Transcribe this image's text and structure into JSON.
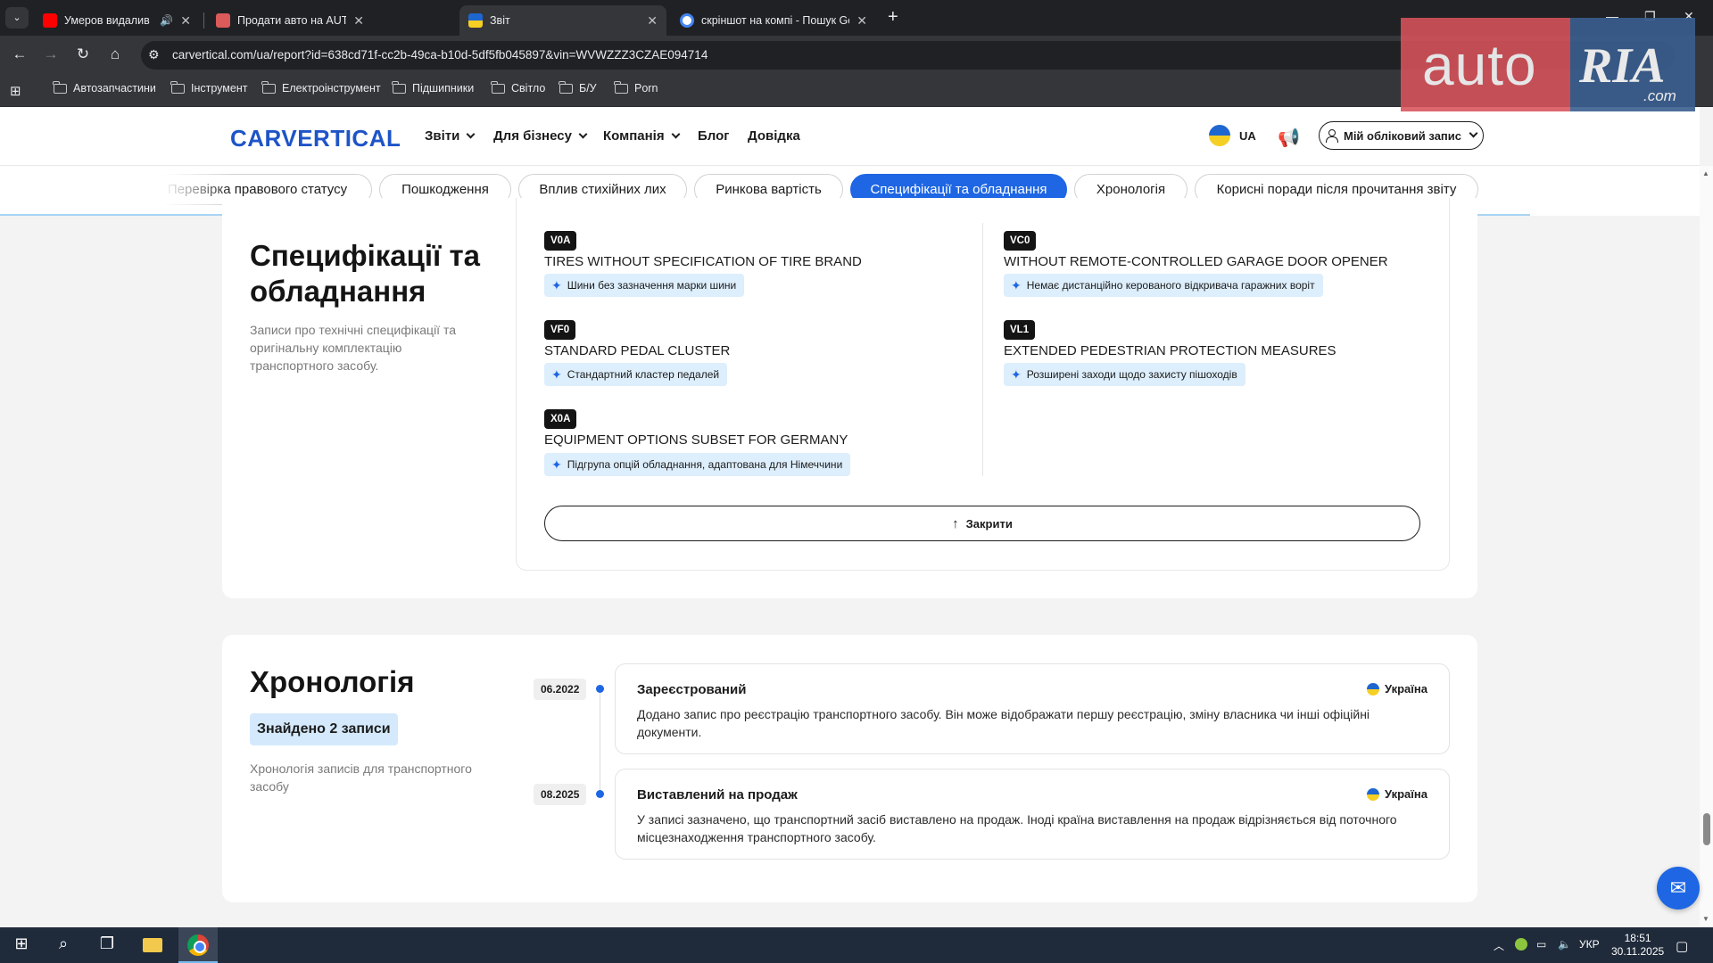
{
  "browser": {
    "tabs": [
      {
        "title": "Умеров видалив повідомл",
        "active": false,
        "favicon_color": "#ff0000"
      },
      {
        "title": "Продати авто на AUTO.RIA - п",
        "active": false,
        "favicon_color": "#db5a5a"
      },
      {
        "title": "Звіт",
        "active": true,
        "favicon_color": "#f5cf24"
      },
      {
        "title": "скріншот на компі - Пошук Go",
        "active": false,
        "favicon_color": "#4285f4"
      }
    ],
    "url": "carvertical.com/ua/report?id=638cd71f-cc2b-49ca-b10d-5df5fb045897&vin=WVWZZZ3CZAE094714",
    "bookmarks": [
      "Автозапчастини",
      "Інструмент",
      "Електроінструмент",
      "Підшипники",
      "Світло",
      "Б/У",
      "Porn"
    ]
  },
  "overlay": {
    "auto": "auto",
    "ria": "RIA",
    "com": ".com"
  },
  "header": {
    "logo": "CARVERTICAL",
    "nav": [
      {
        "label": "Звіти",
        "dropdown": true
      },
      {
        "label": "Для бізнесу",
        "dropdown": true
      },
      {
        "label": "Компанія",
        "dropdown": true
      },
      {
        "label": "Блог",
        "dropdown": false
      },
      {
        "label": "Довідка",
        "dropdown": false
      }
    ],
    "lang": "UA",
    "account": "Мій обліковий запис"
  },
  "subnav": {
    "pills": [
      {
        "label": "Перевірка правового статусу",
        "active": false
      },
      {
        "label": "Пошкодження",
        "active": false
      },
      {
        "label": "Вплив стихійних лих",
        "active": false
      },
      {
        "label": "Ринкова вартість",
        "active": false
      },
      {
        "label": "Специфікації та обладнання",
        "active": true
      },
      {
        "label": "Хронологія",
        "active": false
      },
      {
        "label": "Корисні поради після прочитання звіту",
        "active": false
      }
    ],
    "progress": 0.9
  },
  "specs": {
    "title": "Специфікації та обладнання",
    "description": "Записи про технічні специфікації та оригінальну комплектацію транспортного засобу.",
    "left": [
      {
        "code": "V0A",
        "name": "TIRES WITHOUT SPECIFICATION OF TIRE BRAND",
        "translation": "Шини без зазначення марки шини"
      },
      {
        "code": "VF0",
        "name": "STANDARD PEDAL CLUSTER",
        "translation": "Стандартний кластер педалей"
      },
      {
        "code": "X0A",
        "name": "EQUIPMENT OPTIONS SUBSET FOR GERMANY",
        "translation": "Підгрупа опцій обладнання, адаптована для Німеччини"
      }
    ],
    "right": [
      {
        "code": "VC0",
        "name": "WITHOUT REMOTE-CONTROLLED GARAGE DOOR OPENER",
        "translation": "Немає дистанційно керованого відкривача гаражних воріт"
      },
      {
        "code": "VL1",
        "name": "EXTENDED PEDESTRIAN PROTECTION MEASURES",
        "translation": "Розширені заходи щодо захисту пішоходів"
      }
    ],
    "close_label": "Закрити"
  },
  "chronology": {
    "title": "Хронологія",
    "found": "Знайдено 2 записи",
    "description": "Хронологія записів для транспортного засобу",
    "events": [
      {
        "date": "06.2022",
        "title": "Зареєстрований",
        "country": "Україна",
        "description": "Додано запис про реєстрацію транспортного засобу. Він може відображати першу реєстрацію, зміну власника чи інші офіційні документи."
      },
      {
        "date": "08.2025",
        "title": "Виставлений на продаж",
        "country": "Україна",
        "description": "У записі зазначено, що транспортний засіб виставлено на продаж. Іноді країна виставлення на продаж відрізняється від поточного місцезнаходження транспортного засобу."
      }
    ]
  },
  "taskbar": {
    "lang": "УКР",
    "time": "18:51",
    "date": "30.11.2025"
  },
  "colors": {
    "brand": "#1e54c7",
    "accent": "#1e66e3",
    "chip": "#ddeefc"
  }
}
